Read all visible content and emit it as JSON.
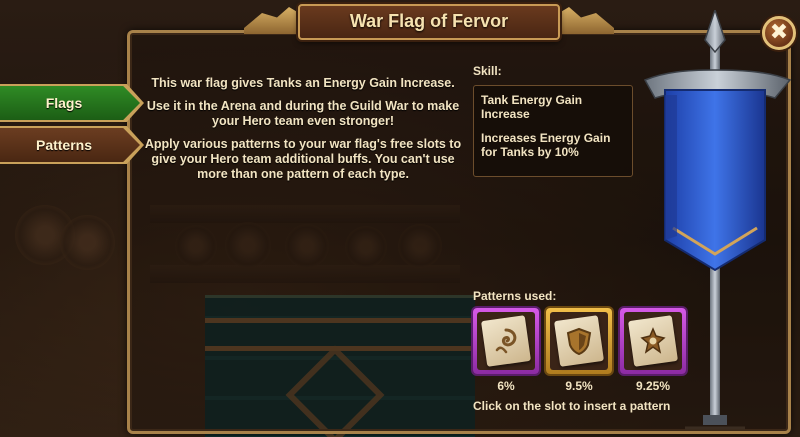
{
  "window": {
    "title": "War Flag of Fervor",
    "close_glyph": "✖"
  },
  "tabs": [
    {
      "label": "Flags",
      "active": true
    },
    {
      "label": "Patterns",
      "active": false
    }
  ],
  "description": {
    "paragraphs": [
      "This war flag gives Tanks an Energy Gain Increase.",
      "Use it in the Arena and during the Guild War to make your Hero team even stronger!",
      "Apply various patterns to your war flag's free slots to give your Hero team additional buffs. You can't use more than one pattern of each type."
    ]
  },
  "skill": {
    "label": "Skill:",
    "name": "Tank Energy Gain Increase",
    "effect": "Increases Energy Gain for Tanks by 10%"
  },
  "patterns": {
    "label": "Patterns used:",
    "slots": [
      {
        "value": "6%",
        "rarity": "purple",
        "icon": "swirl-pattern-icon"
      },
      {
        "value": "9.5%",
        "rarity": "gold",
        "icon": "shield-pattern-icon"
      },
      {
        "value": "9.25%",
        "rarity": "purple",
        "icon": "helmet-pattern-icon"
      }
    ],
    "hint": "Click on the slot to insert a pattern"
  },
  "colors": {
    "frame_gold": "#c89a55",
    "tab_active": "#2f8b25",
    "tab_inactive": "#6b3d21",
    "rarity_purple": "#d65ae8",
    "rarity_gold": "#f2c04a",
    "banner_blue": "#2f5fd6",
    "text_cream": "#f2e4c2"
  }
}
